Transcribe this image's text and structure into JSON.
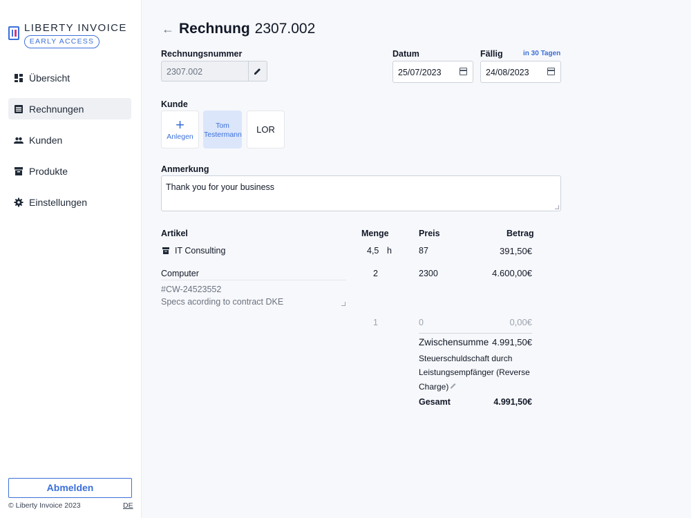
{
  "sidebar": {
    "brand": "LIBERTY INVOICE",
    "badge": "EARLY ACCESS",
    "items": [
      {
        "label": "Übersicht",
        "icon": "dashboard-icon",
        "active": false
      },
      {
        "label": "Rechnungen",
        "icon": "list-icon",
        "active": true
      },
      {
        "label": "Kunden",
        "icon": "people-icon",
        "active": false
      },
      {
        "label": "Produkte",
        "icon": "archive-icon",
        "active": false
      },
      {
        "label": "Einstellungen",
        "icon": "gear-icon",
        "active": false
      }
    ],
    "logout": "Abmelden",
    "copyright": "© Liberty Invoice 2023",
    "lang": "DE"
  },
  "header": {
    "title_word": "Rechnung",
    "invoice_number": "2307.002"
  },
  "form": {
    "number_label": "Rechnungsnummer",
    "number_value": "2307.002",
    "date_label": "Datum",
    "date_value": "25/07/2023",
    "due_label": "Fällig",
    "due_hint": "in 30 Tagen",
    "due_value": "24/08/2023",
    "customer_label": "Kunde",
    "customers": {
      "add": "Anlegen",
      "selected_line1": "Tom",
      "selected_line2": "Testermann",
      "other": "LOR"
    },
    "note_label": "Anmerkung",
    "note_value": "Thank you for your business"
  },
  "items": {
    "headers": {
      "article": "Artikel",
      "qty": "Menge",
      "price": "Preis",
      "amount": "Betrag"
    },
    "rows": [
      {
        "name": "IT Consulting",
        "qty": "4,5",
        "unit": "h",
        "price": "87",
        "amount": "391,50€"
      },
      {
        "name": "Computer",
        "desc1": "#CW-24523552",
        "desc2": "Specs acording to contract DKE",
        "qty": "2",
        "price": "2300",
        "amount": "4.600,00€"
      },
      {
        "qty": "1",
        "price": "0",
        "amount": "0,00€"
      }
    ]
  },
  "totals": {
    "subtotal_label": "Zwischensumme",
    "subtotal_value": "4.991,50€",
    "tax_line1": "Steuerschuldschaft durch",
    "tax_line2": "Leistungsempfänger (Reverse",
    "tax_line3": "Charge)",
    "total_label": "Gesamt",
    "total_value": "4.991,50€"
  },
  "colors": {
    "accent": "#3b6fd8",
    "sidebar_active": "#eef0f4",
    "selected_card": "#dbe6fb"
  }
}
